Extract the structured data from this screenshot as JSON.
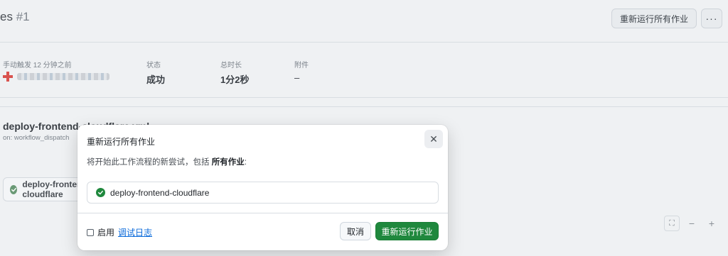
{
  "header": {
    "title": "es",
    "run_number": "#1",
    "rerun_all_label": "重新运行所有作业",
    "more_label": "···"
  },
  "summary": {
    "trigger_label": "手动触发 12 分钟之前",
    "status_label": "状态",
    "status_value": "成功",
    "duration_label": "总时长",
    "duration_value": "1分2秒",
    "artifacts_label": "附件",
    "artifacts_value": "–"
  },
  "workflow": {
    "name": "deploy-frontend-cloudflare.yml",
    "trigger": "on: workflow_dispatch",
    "job_label": "deploy-frontend-cloudflare"
  },
  "graph_controls": {
    "fullscreen": "⛶",
    "zoom_out": "−",
    "zoom_in": "+"
  },
  "modal": {
    "title": "重新运行所有作业",
    "close": "✕",
    "desc_prefix": "将开始此工作流程的新尝试，包括 ",
    "desc_bold": "所有作业",
    "desc_suffix": ":",
    "job_label": "deploy-frontend-cloudflare",
    "debug_prefix": "启用 ",
    "debug_link": "调试日志",
    "cancel_label": "取消",
    "confirm_label": "重新运行作业"
  },
  "colors": {
    "success": "#1f883d",
    "link": "#0969da"
  }
}
